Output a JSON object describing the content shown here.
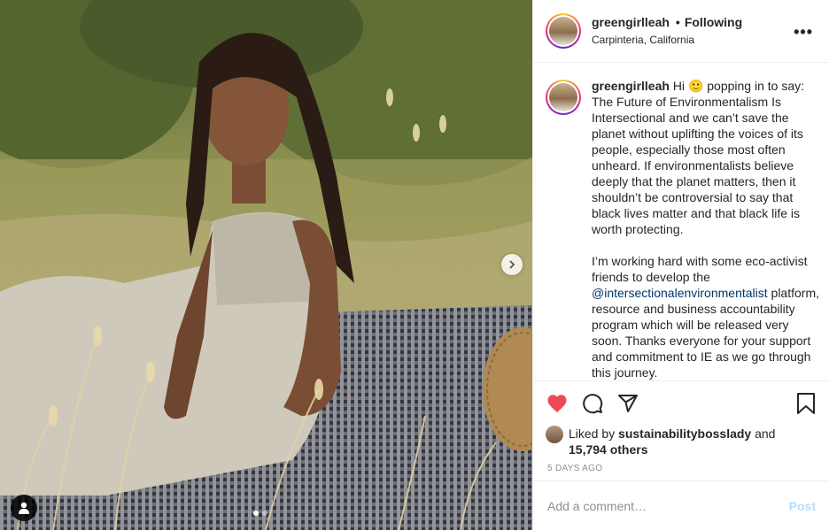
{
  "photo": {
    "next_icon": "chevron-right-icon",
    "tag_icon": "user-tag-icon",
    "dots": [
      true,
      false
    ]
  },
  "header": {
    "username": "greengirlleah",
    "separator": "•",
    "follow_status": "Following",
    "location": "Carpinteria, California",
    "more_label": "•••"
  },
  "caption": {
    "username": "greengirlleah",
    "intro": "Hi",
    "emoji": "🙂",
    "para1": "popping in to say: The Future of Environmentalism Is Intersectional and we can’t save the planet without uplifting the voices of its people, especially those most often unheard. If environmentalists believe deeply that the planet matters, then it shouldn’t be controversial to say that black lives matter and that black life is worth protecting.",
    "para2_start": "I’m working hard with some eco-activist friends to develop the",
    "mention": "@intersectionalenvironmentalist",
    "para2_end": "platform, resource and business accountability program which will be released very soon. Thanks everyone for your support and commitment to IE as we go through this journey."
  },
  "actions": {
    "like_icon": "heart-filled-icon",
    "comment_icon": "comment-icon",
    "share_icon": "share-icon",
    "save_icon": "bookmark-icon",
    "like_color": "#ed4956",
    "liked_prefix": "Liked by",
    "liked_user": "sustainabilitybosslady",
    "liked_and": "and",
    "liked_others": "15,794 others",
    "timestamp": "5 DAYS AGO"
  },
  "comment": {
    "placeholder": "Add a comment…",
    "post_label": "Post",
    "post_color": "#b2dffc"
  }
}
